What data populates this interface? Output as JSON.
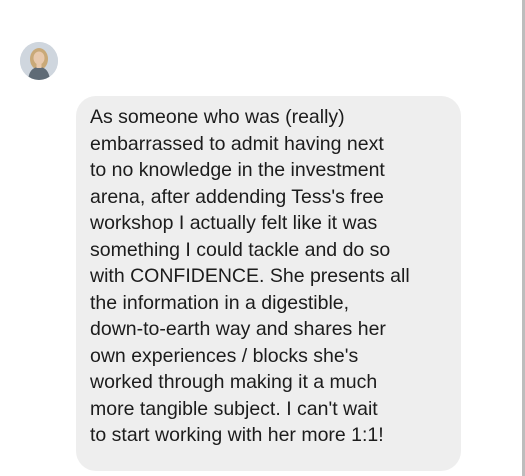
{
  "chat": {
    "sender_avatar_icon": "user-avatar-photo",
    "message": {
      "lines": [
        "As someone who was (really)",
        "embarrassed to admit having next",
        "to no knowledge in the investment",
        "arena, after addending Tess's free",
        "workshop I actually felt like it was",
        "something I could tackle and do so",
        "with CONFIDENCE. She presents all",
        "the information in a digestible,",
        "down-to-earth way and shares her",
        "own experiences / blocks she's",
        "worked through making it a much",
        "more tangible subject. I can't wait",
        "to start working with her more 1:1!"
      ]
    }
  },
  "colors": {
    "bubble_background": "#eeeeee",
    "text": "#1c1c1c",
    "page_background": "#ffffff"
  }
}
